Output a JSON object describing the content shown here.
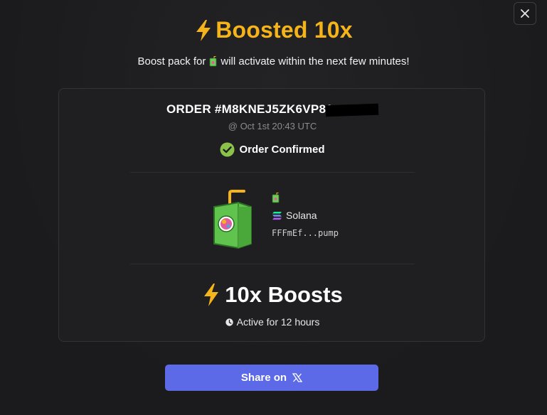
{
  "header": {
    "title": "Boosted 10x",
    "subtitle_before": "Boost pack for",
    "subtitle_after": "will activate within the next few minutes!"
  },
  "order": {
    "id": "ORDER #M8KNEJ5ZK6VP81",
    "time": "@ Oct 1st 20:43 UTC",
    "status": "Order Confirmed"
  },
  "token": {
    "chain": "Solana",
    "address": "FFFmEf...pump"
  },
  "boost": {
    "amount": "10x Boosts",
    "duration": "Active for 12 hours"
  },
  "share": {
    "label": "Share on"
  },
  "icons": {
    "close": "close-icon",
    "bolt": "lightning-bolt-icon",
    "check": "check-circle-icon",
    "token": "juice-box-icon",
    "chain": "solana-icon",
    "clock": "clock-icon",
    "x": "x-logo-icon"
  },
  "colors": {
    "accent": "#f4b41a",
    "button": "#5c6ae8",
    "confirmed": "#8bc34a"
  }
}
